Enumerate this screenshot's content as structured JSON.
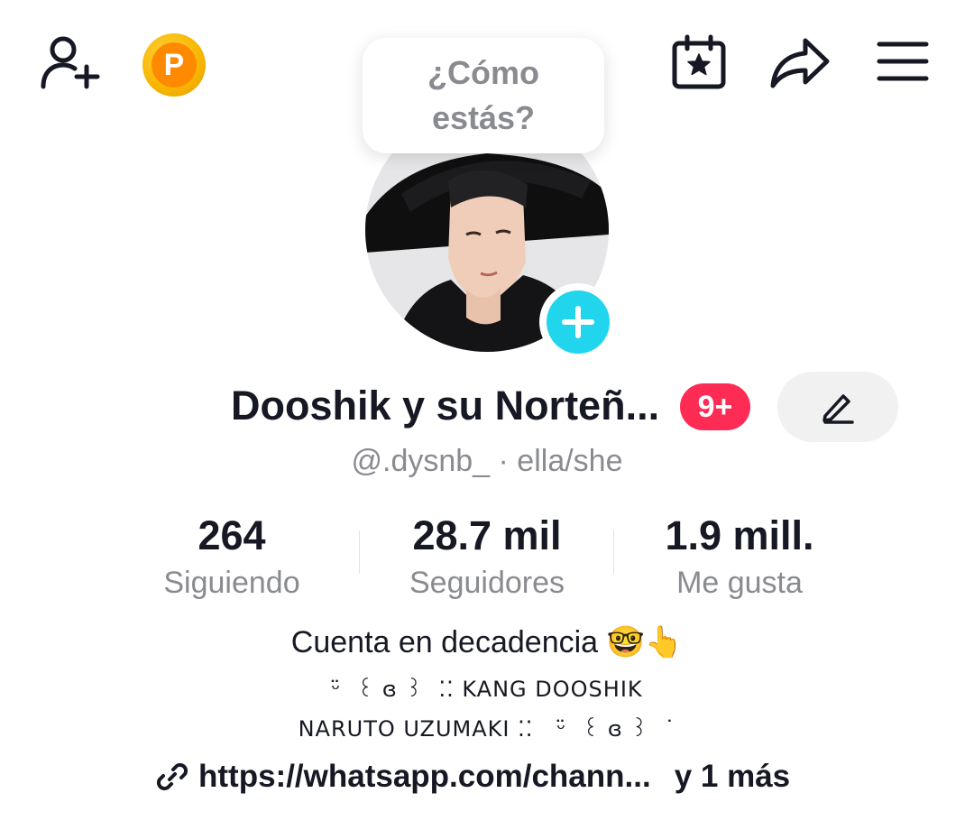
{
  "profile": {
    "status_bubble": "¿Cómo\nestás?",
    "display_name": "Dooshik y su Norteñ...",
    "notification_badge": "9+",
    "handle_line": "@.dysnb_ · ella/she"
  },
  "stats": [
    {
      "value": "264",
      "label": "Siguiendo"
    },
    {
      "value": "28.7 mil",
      "label": "Seguidores"
    },
    {
      "value": "1.9 mill.",
      "label": "Me gusta"
    }
  ],
  "bio": {
    "line1": "Cuenta en decadencia 🤓👆",
    "line2": "ᵕ̈  ꒰ ɞ ꒱  ⁚⁚ KANG DOOSHIK",
    "line3": "NARUTO UZUMAKI ⁚⁚   ᵕ̈  ꒰ ɞ ꒱  ˙"
  },
  "link": {
    "url_text": "https://whatsapp.com/chann...",
    "more_text": "y 1 más"
  },
  "coin_letter": "P",
  "icons": {
    "add_friend": "add-friend-icon",
    "coin": "coin-icon",
    "calendar": "calendar-star-icon",
    "share": "share-icon",
    "menu": "menu-icon",
    "edit": "pencil-icon",
    "link": "link-icon",
    "avatar_add": "plus-icon"
  },
  "colors": {
    "accent_pink": "#fe2c55",
    "accent_cyan": "#20d5ec",
    "text_primary": "#161823",
    "text_secondary": "#8a8b91",
    "coin_orange": "#ff8a00"
  }
}
